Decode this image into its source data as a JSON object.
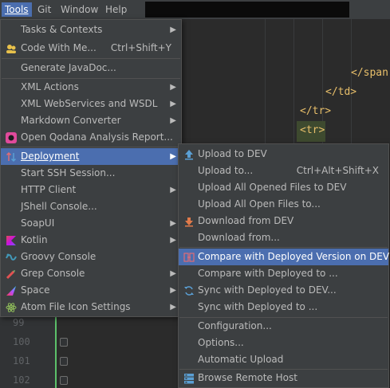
{
  "menubar": {
    "items": [
      {
        "label": "Tools",
        "active": true
      },
      {
        "label": "Git"
      },
      {
        "label": "Window"
      },
      {
        "label": "Help"
      }
    ]
  },
  "editor": {
    "code_lines": [
      "</span",
      "</td>",
      "</tr>",
      "<tr>"
    ],
    "line_numbers": [
      "99",
      "100",
      "101",
      "102"
    ]
  },
  "tools_menu": {
    "items": [
      {
        "label": "Tasks & Contexts",
        "submenu": true
      },
      {
        "label": "Code With Me...",
        "shortcut": "Ctrl+Shift+Y",
        "icon": "code-with-me-icon"
      },
      {
        "label": "Generate JavaDoc..."
      },
      {
        "label": "XML Actions",
        "submenu": true
      },
      {
        "label": "XML WebServices and WSDL",
        "submenu": true
      },
      {
        "label": "Markdown Converter",
        "submenu": true
      },
      {
        "label": "Open Qodana Analysis Report...",
        "icon": "qodana-icon"
      },
      {
        "label": "Deployment",
        "submenu": true,
        "selected": true,
        "icon": "deployment-icon"
      },
      {
        "label": "Start SSH Session..."
      },
      {
        "label": "HTTP Client",
        "submenu": true
      },
      {
        "label": "JShell Console..."
      },
      {
        "label": "SoapUI",
        "submenu": true
      },
      {
        "label": "Kotlin",
        "submenu": true,
        "icon": "kotlin-icon"
      },
      {
        "label": "Groovy Console",
        "icon": "groovy-icon"
      },
      {
        "label": "Grep Console",
        "submenu": true,
        "icon": "grep-console-icon"
      },
      {
        "label": "Space",
        "submenu": true,
        "icon": "space-icon"
      },
      {
        "label": "Atom File Icon Settings",
        "submenu": true,
        "icon": "atom-icon"
      }
    ]
  },
  "deployment_menu": {
    "items": [
      {
        "label": "Upload to DEV",
        "icon": "upload-icon"
      },
      {
        "label": "Upload to...",
        "shortcut": "Ctrl+Alt+Shift+X"
      },
      {
        "label": "Upload All Opened Files to DEV"
      },
      {
        "label": "Upload All Open Files to..."
      },
      {
        "label": "Download from DEV",
        "icon": "download-icon"
      },
      {
        "label": "Download from..."
      },
      {
        "label": "Compare with Deployed Version on DEV",
        "selected": true,
        "icon": "compare-icon"
      },
      {
        "label": "Compare with Deployed to ..."
      },
      {
        "label": "Sync with Deployed to DEV...",
        "icon": "sync-icon"
      },
      {
        "label": "Sync with Deployed to ..."
      },
      {
        "label": "Configuration..."
      },
      {
        "label": "Options..."
      },
      {
        "label": "Automatic Upload"
      },
      {
        "label": "Browse Remote Host",
        "icon": "remote-host-icon"
      }
    ]
  },
  "colors": {
    "menu_bg": "#3c3f41",
    "selection": "#4b6eaf",
    "text": "#bbbbbb",
    "tag": "#e8bf6a"
  }
}
